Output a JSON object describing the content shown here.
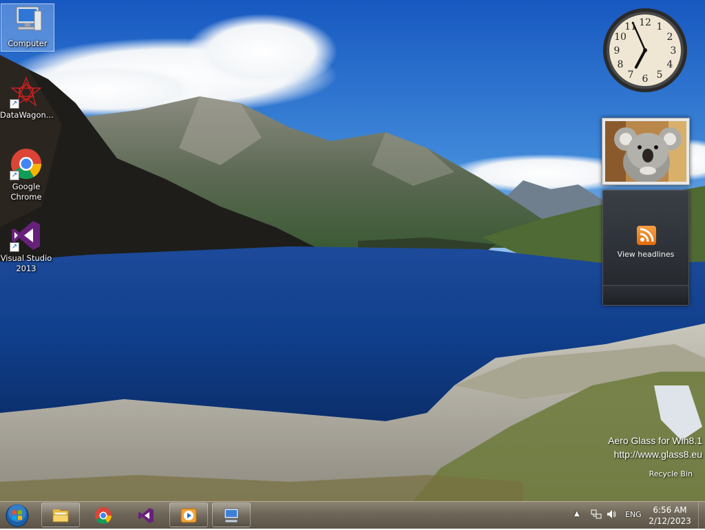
{
  "desktop": {
    "icons": [
      {
        "label": "Computer"
      },
      {
        "label": "DataWagon..."
      },
      {
        "label": "Google Chrome"
      },
      {
        "label": "Visual Studio 2013"
      }
    ]
  },
  "gadgets": {
    "clock": {
      "hour": 6,
      "minute": 56
    },
    "feed": {
      "headline_label": "View headlines"
    }
  },
  "watermark": {
    "line1": "Aero Glass for Win8.1",
    "line2": "http://www.glass8.eu"
  },
  "recycle_bin": {
    "label": "Recycle Bin"
  },
  "taskbar": {
    "pinned": [
      "start-orb-icon",
      "file-explorer-icon",
      "chrome-icon",
      "visual-studio-icon",
      "media-player-icon",
      "remote-desktop-icon"
    ],
    "tray": {
      "language": "ENG",
      "time": "6:56 AM",
      "date": "2/12/2023"
    }
  }
}
